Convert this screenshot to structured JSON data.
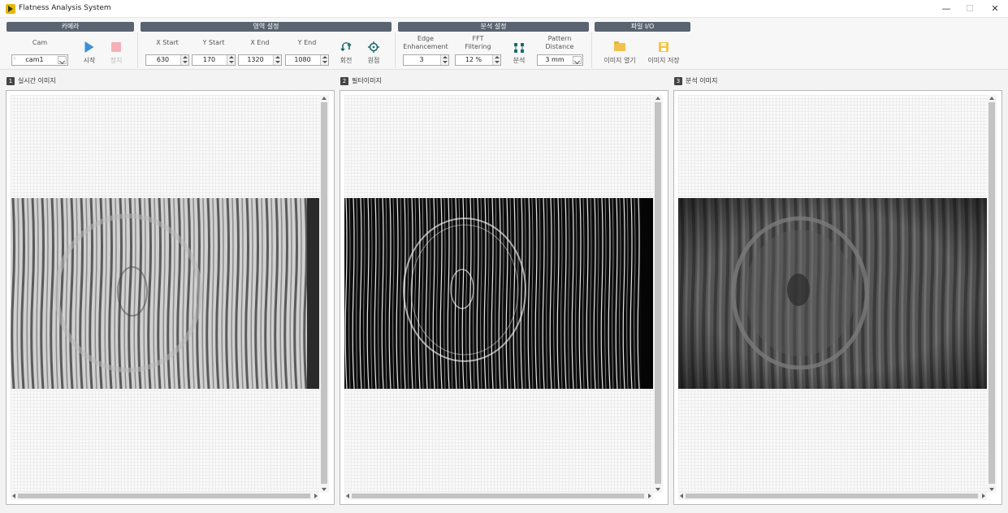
{
  "window": {
    "title": "Flatness Analysis System"
  },
  "groups": {
    "camera": "카메라",
    "region": "영역 설정",
    "analysis": "분석 설정",
    "file_io": "파일 I/O"
  },
  "camera": {
    "cam_label": "Cam",
    "cam_value": "cam1",
    "start_label": "시작",
    "stop_label": "정지"
  },
  "region": {
    "x_start_label": "X Start",
    "x_start": "630",
    "y_start_label": "Y Start",
    "y_start": "170",
    "x_end_label": "X End",
    "x_end": "1320",
    "y_end_label": "Y End",
    "y_end": "1080",
    "rotate_label": "회전",
    "origin_label": "원점"
  },
  "analysis": {
    "edge_label_1": "Edge",
    "edge_label_2": "Enhancement",
    "edge_value": "3",
    "fft_label_1": "FFT",
    "fft_label_2": "Filtering",
    "fft_value": "12 %",
    "analyze_label": "분석",
    "pattern_label_1": "Pattern",
    "pattern_label_2": "Distance",
    "pattern_value": "3 mm"
  },
  "file_io": {
    "open_label": "이미지 열기",
    "save_label": "이미지 저장"
  },
  "panels": [
    {
      "number": "1",
      "title": "실시간 이미지"
    },
    {
      "number": "2",
      "title": "필터이미지"
    },
    {
      "number": "3",
      "title": "분석 이미지"
    }
  ],
  "colors": {
    "group_header": "#5a6470",
    "start_icon": "#3d8fd6",
    "stop_icon_disabled": "#f6b0b8",
    "accent_icon": "#1a6b6b",
    "folder_icon": "#f0c24c"
  }
}
